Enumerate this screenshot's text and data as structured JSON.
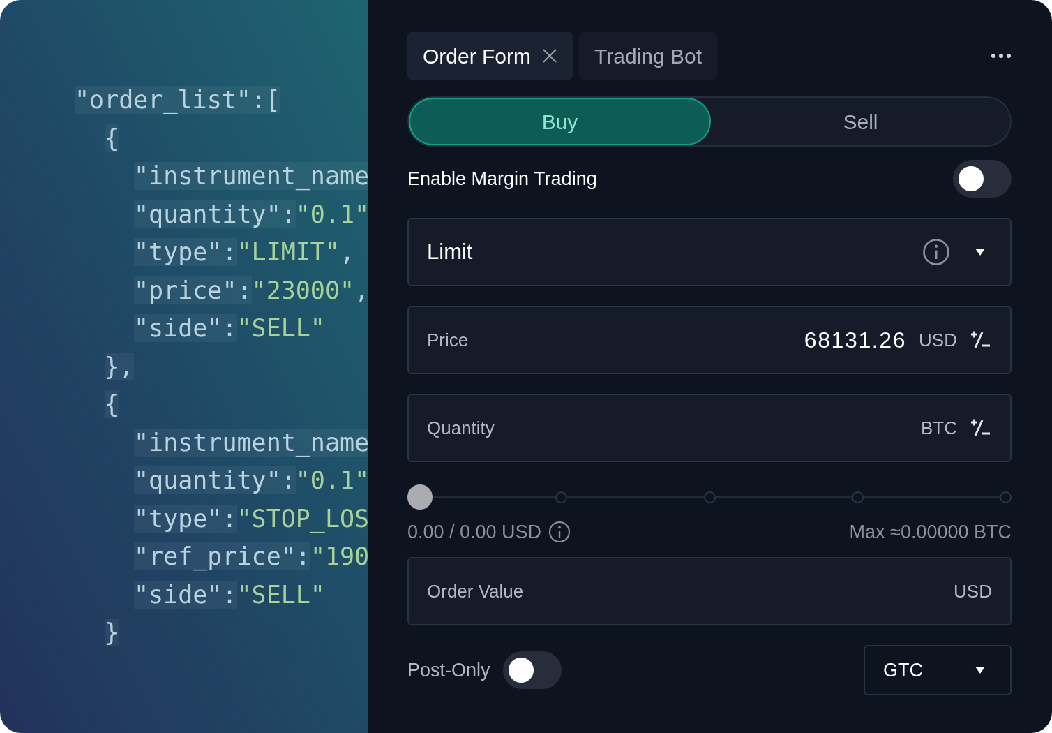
{
  "code": [
    {
      "key": "\"order_list\":[",
      "children": [
        {
          "key": "{",
          "children": [
            {
              "key": "\"instrument_name"
            },
            {
              "key": "\"quantity\":",
              "value": "\"0.1\""
            },
            {
              "key": "\"type\":",
              "value": "\"LIMIT\"",
              "tail": ","
            },
            {
              "key": "\"price\":",
              "value": "\"23000\"",
              "tail": ","
            },
            {
              "key": "\"side\":",
              "value": "\"SELL\""
            }
          ]
        },
        {
          "key": "},"
        },
        {
          "key": "{",
          "children": [
            {
              "key": "\"instrument_name"
            },
            {
              "key": "\"quantity\":",
              "value": "\"0.1\""
            },
            {
              "key": "\"type\":",
              "value": "\"STOP_LOS"
            },
            {
              "key": "\"ref_price\":",
              "value": "\"190"
            },
            {
              "key": "\"side\":",
              "value": "\"SELL\""
            }
          ]
        },
        {
          "key": "}"
        }
      ]
    }
  ],
  "tabs": [
    {
      "label": "Order Form",
      "selected": true,
      "closable": true
    },
    {
      "label": "Trading Bot",
      "selected": false,
      "closable": false
    }
  ],
  "side": [
    {
      "label": "Buy",
      "selected": true
    },
    {
      "label": "Sell",
      "selected": false
    }
  ],
  "margin": {
    "label": "Enable Margin Trading",
    "on": false
  },
  "order_type": {
    "value": "Limit"
  },
  "fields": [
    {
      "label": "Price",
      "value": "68131.26",
      "unit": "USD",
      "stepper": true
    },
    {
      "label": "Quantity",
      "unit": "BTC",
      "stepper": true
    }
  ],
  "slider": {
    "level": 0,
    "reading": "0.00 / 0.00 USD",
    "max": "Max ≈0.00000 BTC"
  },
  "order_value": {
    "label": "Order Value",
    "unit": "USD"
  },
  "post_only": {
    "label": "Post-Only",
    "on": false
  },
  "time_in_force": {
    "value": "GTC"
  }
}
